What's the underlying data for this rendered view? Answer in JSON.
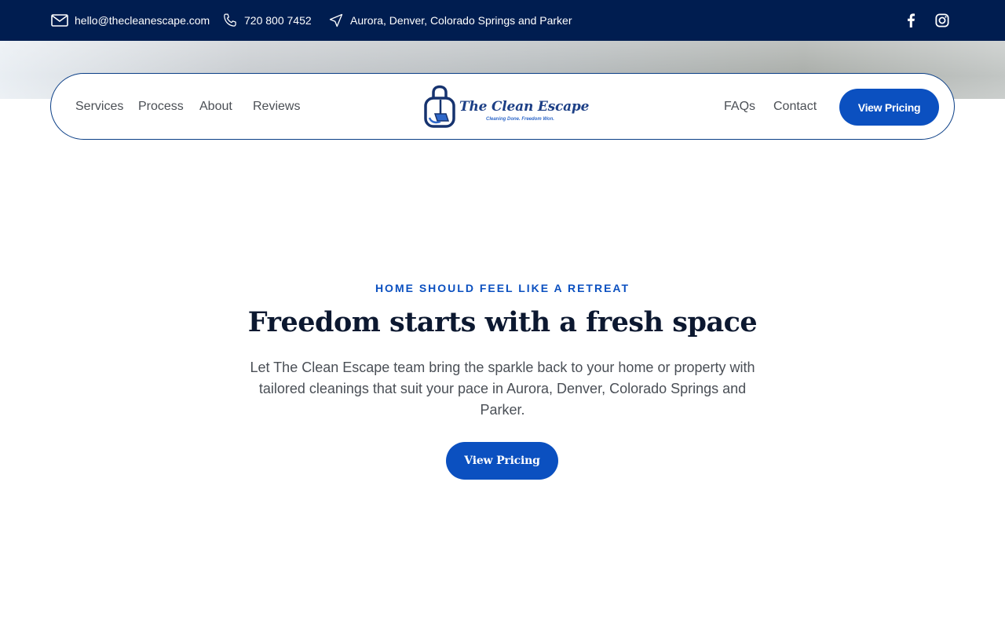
{
  "topbar": {
    "email": "hello@thecleanescape.com",
    "phone": "720 800 7452",
    "locations": "Aurora, Denver, Colorado Springs and Parker",
    "icons": {
      "email": "envelope-icon",
      "phone": "phone-icon",
      "location": "navigation-arrow-icon",
      "facebook": "facebook-icon",
      "instagram": "instagram-icon"
    }
  },
  "nav": {
    "left_links": [
      "Services",
      "Process",
      "About",
      "Reviews"
    ],
    "right_links": [
      "FAQs",
      "Contact"
    ],
    "cta": "View Pricing",
    "logo": {
      "wordmark": "The Clean Escape",
      "tagline": "Cleaning Done. Freedom Won.",
      "icon": "padlock-broom-icon"
    }
  },
  "hero": {
    "eyebrow": "HOME SHOULD FEEL LIKE A RETREAT",
    "headline": "Freedom starts with a fresh space",
    "lede": "Let The Clean Escape team bring the sparkle back to your home or property with tailored cleanings that suit your pace in Aurora, Denver, Colorado Springs and Parker.",
    "cta": "View Pricing"
  },
  "colors": {
    "topbar": "#001d50",
    "accent": "#0b50c0",
    "nav_border": "#0a3e86",
    "headline": "#0c1830"
  }
}
